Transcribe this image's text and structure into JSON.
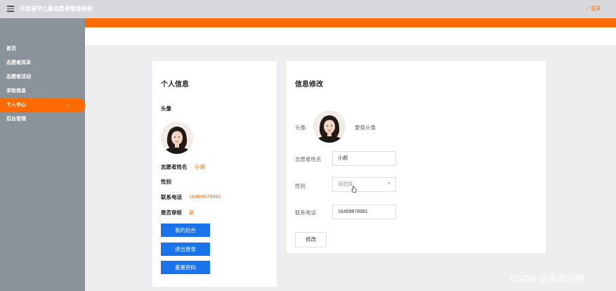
{
  "header": {
    "menu_icon": "hamburger-icon",
    "title": "关爱留守儿童志愿者管理系统",
    "login_icon": "user-icon",
    "login_label": "登录"
  },
  "sidebar": {
    "items": [
      {
        "label": "首页",
        "active": false
      },
      {
        "label": "志愿者风采",
        "active": false
      },
      {
        "label": "志愿者活动",
        "active": false
      },
      {
        "label": "求助信息",
        "active": false
      },
      {
        "label": "个人中心",
        "active": true
      },
      {
        "label": "后台管理",
        "active": false
      }
    ],
    "active_chevron_icon": "chevron-down-icon"
  },
  "profile": {
    "title": "个人信息",
    "avatar_label": "头像",
    "name_label": "志愿者姓名",
    "name_value": "小郝",
    "gender_label": "性别",
    "gender_value": "",
    "phone_label": "联系电话",
    "phone_value": "16459878981",
    "audit_label": "是否审核",
    "audit_value": "是",
    "buttons": {
      "dashboard": "我的后台",
      "logout": "退出登录",
      "reset_password": "重置密码"
    }
  },
  "edit": {
    "title": "信息修改",
    "avatar_label": "头像:",
    "change_avatar_label": "更换头像",
    "name_label": "志愿者姓名",
    "name_value": "小郝",
    "gender_label": "性别",
    "gender_placeholder": "请选择",
    "phone_label": "联系电话",
    "phone_value": "16459878981",
    "submit_label": "修改"
  },
  "watermark": "CSDN @米恩网络",
  "colors": {
    "accent": "#ff6a00",
    "primary_button": "#1a73e8",
    "sidebar": "#8a9399",
    "topbar": "#d8d8dc",
    "background": "#eeeef0"
  }
}
